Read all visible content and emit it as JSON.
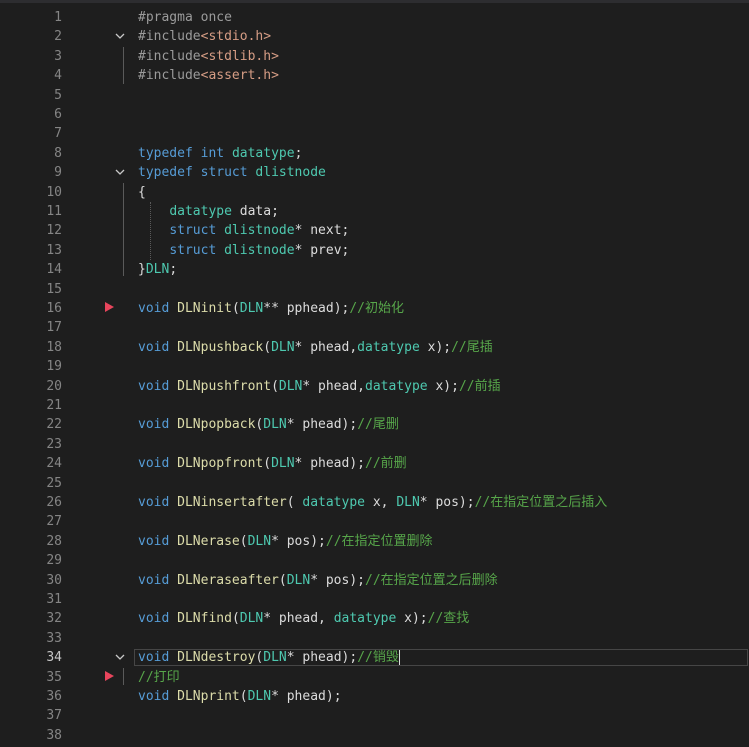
{
  "colors": {
    "background": "#1e1e1e",
    "keyword": "#569cd6",
    "type": "#4ec9b0",
    "function": "#dcdcaa",
    "string": "#d69d85",
    "comment": "#57a64a",
    "preprocessor": "#9b9b9b",
    "text": "#dcdcdc",
    "breakpoint": "#e8455c"
  },
  "editor": {
    "active_line": 34,
    "breakpoint_lines": [
      16,
      35
    ],
    "fold_lines": [
      2,
      9,
      34
    ],
    "lines": [
      {
        "n": "1",
        "tokens": [
          {
            "c": "pre",
            "t": "#pragma once"
          }
        ]
      },
      {
        "n": "2",
        "tokens": [
          {
            "c": "pre",
            "t": "#include"
          },
          {
            "c": "str",
            "t": "<stdio.h>"
          }
        ]
      },
      {
        "n": "3",
        "tokens": [
          {
            "c": "pre",
            "t": "#include"
          },
          {
            "c": "str",
            "t": "<stdlib.h>"
          }
        ]
      },
      {
        "n": "4",
        "tokens": [
          {
            "c": "pre",
            "t": "#include"
          },
          {
            "c": "str",
            "t": "<assert.h>"
          }
        ]
      },
      {
        "n": "5",
        "tokens": []
      },
      {
        "n": "6",
        "tokens": []
      },
      {
        "n": "7",
        "tokens": []
      },
      {
        "n": "8",
        "tokens": [
          {
            "c": "kw",
            "t": "typedef"
          },
          {
            "c": "txt",
            "t": " "
          },
          {
            "c": "kw",
            "t": "int"
          },
          {
            "c": "txt",
            "t": " "
          },
          {
            "c": "ty",
            "t": "datatype"
          },
          {
            "c": "txt",
            "t": ";"
          }
        ]
      },
      {
        "n": "9",
        "tokens": [
          {
            "c": "kw",
            "t": "typedef"
          },
          {
            "c": "txt",
            "t": " "
          },
          {
            "c": "kw",
            "t": "struct"
          },
          {
            "c": "txt",
            "t": " "
          },
          {
            "c": "ty",
            "t": "dlistnode"
          }
        ]
      },
      {
        "n": "10",
        "tokens": [
          {
            "c": "txt",
            "t": "{"
          }
        ]
      },
      {
        "n": "11",
        "tokens": [
          {
            "c": "txt",
            "t": "    "
          },
          {
            "c": "ty",
            "t": "datatype"
          },
          {
            "c": "txt",
            "t": " data;"
          }
        ]
      },
      {
        "n": "12",
        "tokens": [
          {
            "c": "txt",
            "t": "    "
          },
          {
            "c": "kw",
            "t": "struct"
          },
          {
            "c": "txt",
            "t": " "
          },
          {
            "c": "ty",
            "t": "dlistnode"
          },
          {
            "c": "txt",
            "t": "* next;"
          }
        ]
      },
      {
        "n": "13",
        "tokens": [
          {
            "c": "txt",
            "t": "    "
          },
          {
            "c": "kw",
            "t": "struct"
          },
          {
            "c": "txt",
            "t": " "
          },
          {
            "c": "ty",
            "t": "dlistnode"
          },
          {
            "c": "txt",
            "t": "* prev;"
          }
        ]
      },
      {
        "n": "14",
        "tokens": [
          {
            "c": "txt",
            "t": "}"
          },
          {
            "c": "ty",
            "t": "DLN"
          },
          {
            "c": "txt",
            "t": ";"
          }
        ]
      },
      {
        "n": "15",
        "tokens": []
      },
      {
        "n": "16",
        "tokens": [
          {
            "c": "kw",
            "t": "void"
          },
          {
            "c": "txt",
            "t": " "
          },
          {
            "c": "fn",
            "t": "DLNinit"
          },
          {
            "c": "txt",
            "t": "("
          },
          {
            "c": "ty",
            "t": "DLN"
          },
          {
            "c": "txt",
            "t": "** pphead);"
          },
          {
            "c": "cm",
            "t": "//初始化"
          }
        ]
      },
      {
        "n": "17",
        "tokens": []
      },
      {
        "n": "18",
        "tokens": [
          {
            "c": "kw",
            "t": "void"
          },
          {
            "c": "txt",
            "t": " "
          },
          {
            "c": "fn",
            "t": "DLNpushback"
          },
          {
            "c": "txt",
            "t": "("
          },
          {
            "c": "ty",
            "t": "DLN"
          },
          {
            "c": "txt",
            "t": "* phead,"
          },
          {
            "c": "ty",
            "t": "datatype"
          },
          {
            "c": "txt",
            "t": " x);"
          },
          {
            "c": "cm",
            "t": "//尾插"
          }
        ]
      },
      {
        "n": "19",
        "tokens": []
      },
      {
        "n": "20",
        "tokens": [
          {
            "c": "kw",
            "t": "void"
          },
          {
            "c": "txt",
            "t": " "
          },
          {
            "c": "fn",
            "t": "DLNpushfront"
          },
          {
            "c": "txt",
            "t": "("
          },
          {
            "c": "ty",
            "t": "DLN"
          },
          {
            "c": "txt",
            "t": "* phead,"
          },
          {
            "c": "ty",
            "t": "datatype"
          },
          {
            "c": "txt",
            "t": " x);"
          },
          {
            "c": "cm",
            "t": "//前插"
          }
        ]
      },
      {
        "n": "21",
        "tokens": []
      },
      {
        "n": "22",
        "tokens": [
          {
            "c": "kw",
            "t": "void"
          },
          {
            "c": "txt",
            "t": " "
          },
          {
            "c": "fn",
            "t": "DLNpopback"
          },
          {
            "c": "txt",
            "t": "("
          },
          {
            "c": "ty",
            "t": "DLN"
          },
          {
            "c": "txt",
            "t": "* phead);"
          },
          {
            "c": "cm",
            "t": "//尾删"
          }
        ]
      },
      {
        "n": "23",
        "tokens": []
      },
      {
        "n": "24",
        "tokens": [
          {
            "c": "kw",
            "t": "void"
          },
          {
            "c": "txt",
            "t": " "
          },
          {
            "c": "fn",
            "t": "DLNpopfront"
          },
          {
            "c": "txt",
            "t": "("
          },
          {
            "c": "ty",
            "t": "DLN"
          },
          {
            "c": "txt",
            "t": "* phead);"
          },
          {
            "c": "cm",
            "t": "//前删"
          }
        ]
      },
      {
        "n": "25",
        "tokens": []
      },
      {
        "n": "26",
        "tokens": [
          {
            "c": "kw",
            "t": "void"
          },
          {
            "c": "txt",
            "t": " "
          },
          {
            "c": "fn",
            "t": "DLNinsertafter"
          },
          {
            "c": "txt",
            "t": "( "
          },
          {
            "c": "ty",
            "t": "datatype"
          },
          {
            "c": "txt",
            "t": " x, "
          },
          {
            "c": "ty",
            "t": "DLN"
          },
          {
            "c": "txt",
            "t": "* pos);"
          },
          {
            "c": "cm",
            "t": "//在指定位置之后插入"
          }
        ]
      },
      {
        "n": "27",
        "tokens": []
      },
      {
        "n": "28",
        "tokens": [
          {
            "c": "kw",
            "t": "void"
          },
          {
            "c": "txt",
            "t": " "
          },
          {
            "c": "fn",
            "t": "DLNerase"
          },
          {
            "c": "txt",
            "t": "("
          },
          {
            "c": "ty",
            "t": "DLN"
          },
          {
            "c": "txt",
            "t": "* pos);"
          },
          {
            "c": "cm",
            "t": "//在指定位置删除"
          }
        ]
      },
      {
        "n": "29",
        "tokens": []
      },
      {
        "n": "30",
        "tokens": [
          {
            "c": "kw",
            "t": "void"
          },
          {
            "c": "txt",
            "t": " "
          },
          {
            "c": "fn",
            "t": "DLNeraseafter"
          },
          {
            "c": "txt",
            "t": "("
          },
          {
            "c": "ty",
            "t": "DLN"
          },
          {
            "c": "txt",
            "t": "* pos);"
          },
          {
            "c": "cm",
            "t": "//在指定位置之后删除"
          }
        ]
      },
      {
        "n": "31",
        "tokens": []
      },
      {
        "n": "32",
        "tokens": [
          {
            "c": "kw",
            "t": "void"
          },
          {
            "c": "txt",
            "t": " "
          },
          {
            "c": "fn",
            "t": "DLNfind"
          },
          {
            "c": "txt",
            "t": "("
          },
          {
            "c": "ty",
            "t": "DLN"
          },
          {
            "c": "txt",
            "t": "* phead, "
          },
          {
            "c": "ty",
            "t": "datatype"
          },
          {
            "c": "txt",
            "t": " x);"
          },
          {
            "c": "cm",
            "t": "//查找"
          }
        ]
      },
      {
        "n": "33",
        "tokens": []
      },
      {
        "n": "34",
        "tokens": [
          {
            "c": "kw",
            "t": "void"
          },
          {
            "c": "txt",
            "t": " "
          },
          {
            "c": "fn",
            "t": "DLNdestroy"
          },
          {
            "c": "txt",
            "t": "("
          },
          {
            "c": "ty",
            "t": "DLN"
          },
          {
            "c": "txt",
            "t": "* phead);"
          },
          {
            "c": "cm",
            "t": "//销毁"
          }
        ]
      },
      {
        "n": "35",
        "tokens": [
          {
            "c": "cm",
            "t": "//打印"
          }
        ]
      },
      {
        "n": "36",
        "tokens": [
          {
            "c": "kw",
            "t": "void"
          },
          {
            "c": "txt",
            "t": " "
          },
          {
            "c": "fn",
            "t": "DLNprint"
          },
          {
            "c": "txt",
            "t": "("
          },
          {
            "c": "ty",
            "t": "DLN"
          },
          {
            "c": "txt",
            "t": "* phead);"
          }
        ]
      },
      {
        "n": "37",
        "tokens": []
      },
      {
        "n": "38",
        "tokens": []
      }
    ]
  }
}
